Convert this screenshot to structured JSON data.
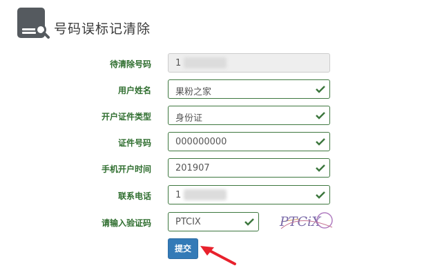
{
  "header": {
    "title": "号码误标记清除",
    "icon": "report-search-icon"
  },
  "form": {
    "fields": [
      {
        "label": "待清除号码",
        "value": "1",
        "masked": true,
        "disabled": true,
        "valid": false
      },
      {
        "label": "用户姓名",
        "value": "果粉之家",
        "valid": true
      },
      {
        "label": "开户证件类型",
        "value": "身份证",
        "valid": true
      },
      {
        "label": "证件号码",
        "value": "000000000",
        "valid": true
      },
      {
        "label": "手机开户时间",
        "value": "201907",
        "valid": true
      },
      {
        "label": "联系电话",
        "value": "1",
        "masked": true,
        "valid": true
      }
    ],
    "captcha": {
      "label": "请输入验证码",
      "value": "PTCIX",
      "image_text": "PTCiX"
    },
    "submit_label": "提交"
  },
  "colors": {
    "valid": "#3c763d",
    "primary": "#337ab7",
    "arrow": "#e8212c"
  }
}
